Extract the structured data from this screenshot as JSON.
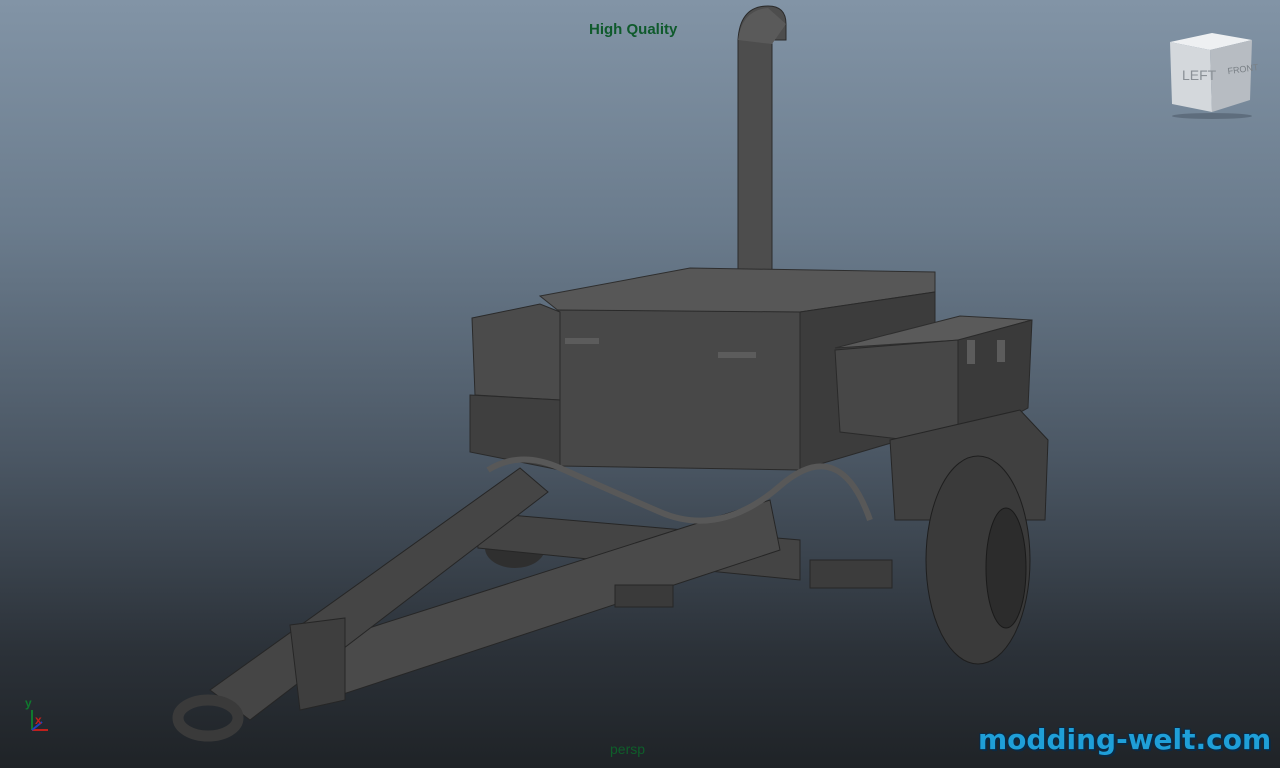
{
  "viewport": {
    "render_quality": "High Quality",
    "camera": "persp",
    "background_top": "#8294a6",
    "background_bottom": "#1f2327"
  },
  "viewcube": {
    "left_face": "LEFT",
    "front_face": "FRONT"
  },
  "axis_indicator": {
    "y_label": "y",
    "x_label": "x",
    "y_color": "#0f7a2e",
    "x_color": "#c0201c"
  },
  "model": {
    "icon": "generator-trailer-model",
    "color": "#4a4a4a"
  },
  "watermark": {
    "text": "modding-welt.com",
    "color": "#1f9fd8"
  }
}
